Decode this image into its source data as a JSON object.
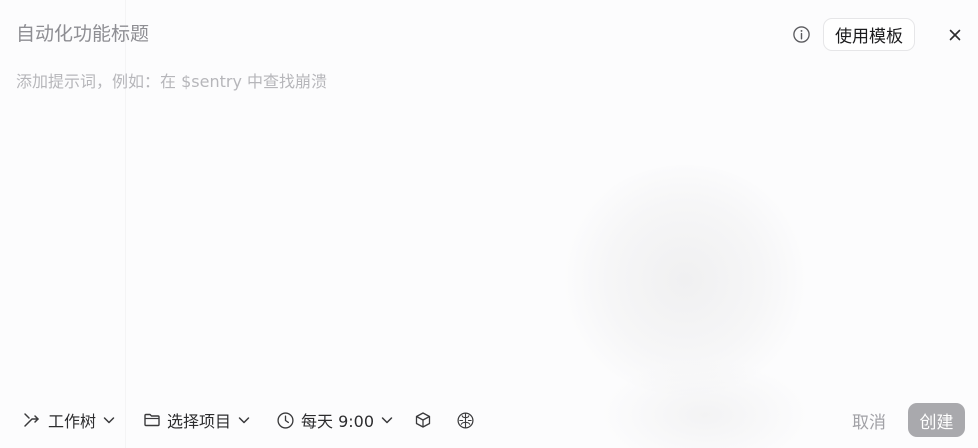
{
  "dialog": {
    "title_placeholder": "自动化功能标题",
    "prompt_placeholder": "添加提示词，例如：在 $sentry 中查找崩溃",
    "use_template_label": "使用模板"
  },
  "toolbar": {
    "worktree_label": "工作树",
    "project_label": "选择项目",
    "schedule_label": "每天 9:00"
  },
  "actions": {
    "cancel_label": "取消",
    "create_label": "创建"
  },
  "icons": {
    "info": "info-circle-icon",
    "close": "close-icon",
    "worktree": "branch-arrow-icon",
    "folder": "folder-icon",
    "clock": "clock-icon",
    "chevron": "chevron-down-icon",
    "cube": "cube-icon",
    "brain": "brain-icon"
  },
  "colors": {
    "create_button_bg": "#a9a9ad",
    "placeholder_text": "#b6b6ba",
    "primary_text": "#1c1c1e"
  }
}
